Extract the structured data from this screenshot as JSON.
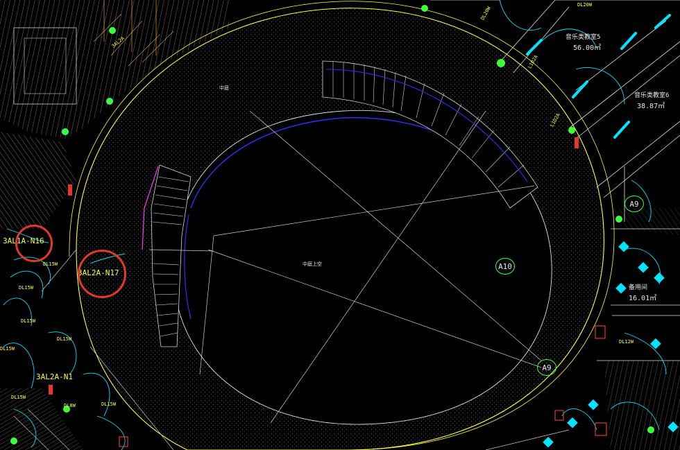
{
  "drawing": {
    "circuit_labels": [
      "3AL1A-N16",
      "3AL2A-N17",
      "3AL2A-N1"
    ],
    "axis_tags": [
      "A10",
      "A9",
      "A9"
    ],
    "rooms": [
      {
        "name": "中庭",
        "area": ""
      },
      {
        "name": "中庭上空",
        "area": ""
      },
      {
        "name": "音乐类教室5",
        "area": "56.00㎡"
      },
      {
        "name": "音乐类教室6",
        "area": "38.87㎡"
      },
      {
        "name": "备用间",
        "area": "16.01㎡"
      }
    ],
    "small_tags": [
      "3AL2A",
      "DL20W",
      "DL15W",
      "DL15W",
      "DL15W",
      "DL15W",
      "DL15W",
      "DL12W",
      "DL15W",
      "L1D2A",
      "L1D2A",
      "DL8W",
      "DL20W",
      "DL15W"
    ],
    "colors": {
      "background": "#000000",
      "outline_yellow": "#ffff40",
      "fixture_cyan": "#00e5ff",
      "annotation_red": "#e23a2a",
      "slab_blue": "#3030ff",
      "axis_green": "#3cff3c"
    }
  }
}
